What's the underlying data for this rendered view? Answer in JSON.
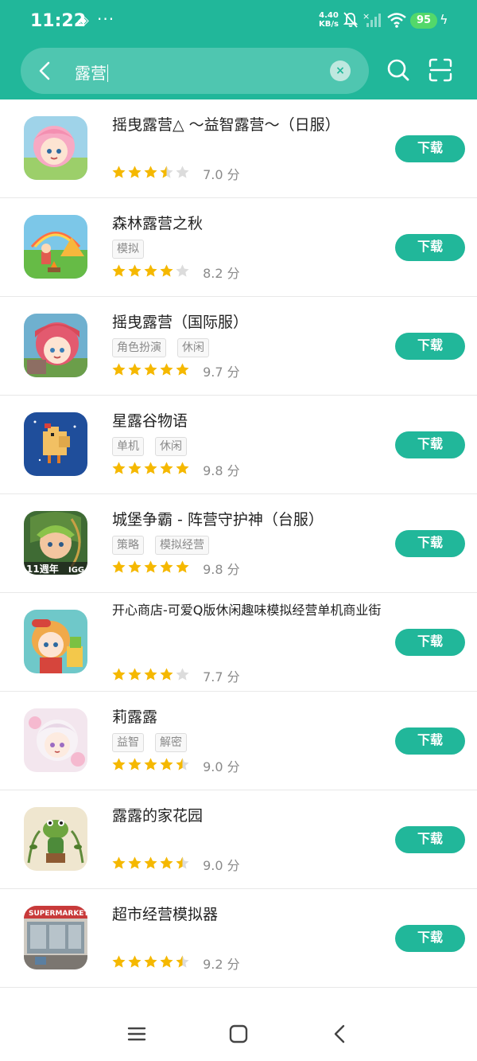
{
  "status_bar": {
    "time": "11:22",
    "speed_value": "4.40",
    "speed_unit": "KB/s",
    "battery": "95"
  },
  "search": {
    "query": "露营",
    "clear_icon": "×"
  },
  "download_label": "下载",
  "score_unit": "分",
  "apps": [
    {
      "name": "摇曳露营△ ～益智露营～（日服）",
      "tags": [],
      "rating": 3.5,
      "score": "7.0"
    },
    {
      "name": "森林露营之秋",
      "tags": [
        "模拟"
      ],
      "rating": 4,
      "score": "8.2"
    },
    {
      "name": "摇曳露营（国际服）",
      "tags": [
        "角色扮演",
        "休闲"
      ],
      "rating": 5,
      "score": "9.7"
    },
    {
      "name": "星露谷物语",
      "tags": [
        "单机",
        "休闲"
      ],
      "rating": 5,
      "score": "9.8"
    },
    {
      "name": "城堡争霸 - 阵营守护神（台服）",
      "tags": [
        "策略",
        "模拟经营"
      ],
      "rating": 5,
      "score": "9.8"
    },
    {
      "name": "开心商店-可爱Q版休闲趣味模拟经营单机商业街",
      "tags": [],
      "rating": 4,
      "score": "7.7"
    },
    {
      "name": "莉露露",
      "tags": [
        "益智",
        "解密"
      ],
      "rating": 4.5,
      "score": "9.0"
    },
    {
      "name": "露露的家花园",
      "tags": [],
      "rating": 4.5,
      "score": "9.0"
    },
    {
      "name": "超市经营模拟器",
      "tags": [],
      "rating": 4.5,
      "score": "9.2"
    }
  ],
  "colors": {
    "brand": "#21b79a",
    "star": "#f5b800",
    "star_empty": "#dcdcdc"
  }
}
